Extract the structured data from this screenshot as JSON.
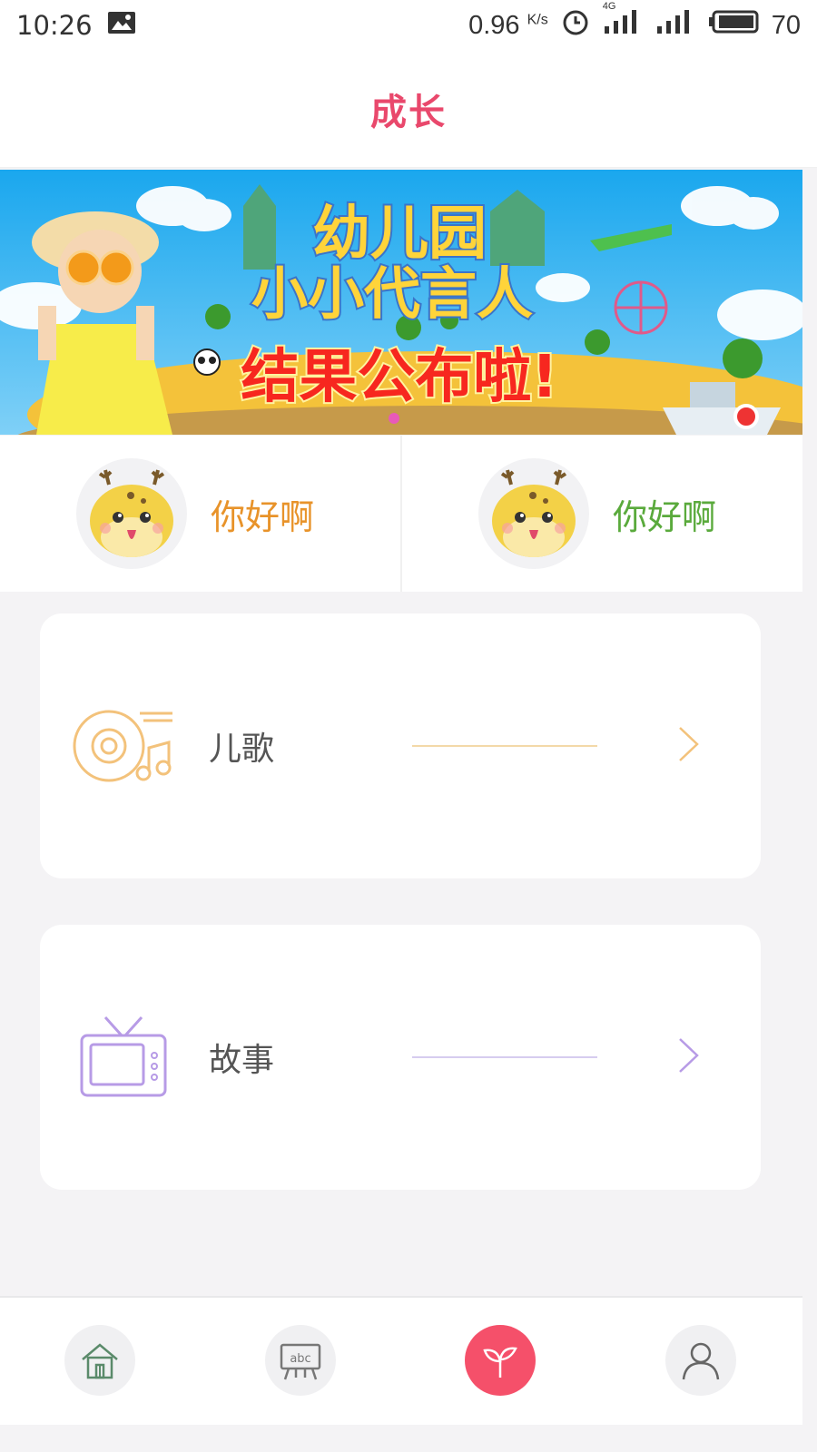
{
  "status_bar": {
    "time": "10:26",
    "speed": "0.96",
    "speed_unit": "K/s",
    "network": "4G",
    "battery": "70"
  },
  "header": {
    "title": "成长"
  },
  "banner": {
    "line1": "幼儿园",
    "line2": "小小代言人",
    "line3": "结果公布啦!"
  },
  "quick_links": [
    {
      "label": "你好啊",
      "color": "#e8932a"
    },
    {
      "label": "你好啊",
      "color": "#5aaa3c"
    }
  ],
  "cards": [
    {
      "label": "儿歌",
      "accent": "#f3c27b",
      "icon": "music-disc-icon"
    },
    {
      "label": "故事",
      "accent": "#b79be6",
      "icon": "tv-icon"
    }
  ],
  "tabs": [
    {
      "name": "home",
      "icon": "house-icon",
      "active": false
    },
    {
      "name": "learn",
      "icon": "abc-board-icon",
      "active": false
    },
    {
      "name": "growth",
      "icon": "sprout-icon",
      "active": true
    },
    {
      "name": "profile",
      "icon": "person-icon",
      "active": false
    }
  ],
  "colors": {
    "accent": "#e9486c",
    "tab_active": "#f5506a"
  }
}
